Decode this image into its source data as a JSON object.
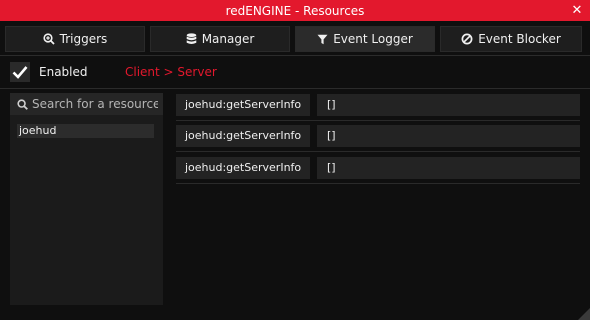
{
  "window": {
    "title": "redENGINE - Resources",
    "close_symbol": "✕"
  },
  "tabs": [
    {
      "label": "Triggers",
      "icon": "search-plus-icon",
      "active": false
    },
    {
      "label": "Manager",
      "icon": "database-icon",
      "active": false
    },
    {
      "label": "Event Logger",
      "icon": "filter-icon",
      "active": true
    },
    {
      "label": "Event Blocker",
      "icon": "ban-icon",
      "active": false
    }
  ],
  "logger": {
    "enabled_label": "Enabled",
    "enabled": true,
    "direction": "Client > Server"
  },
  "resources": {
    "search_placeholder": "Search for a resource",
    "items": [
      {
        "name": "joehud"
      }
    ]
  },
  "events": [
    {
      "name": "joehud:getServerInfo",
      "args": "[]"
    },
    {
      "name": "joehud:getServerInfo",
      "args": "[]"
    },
    {
      "name": "joehud:getServerInfo",
      "args": "[]"
    }
  ],
  "colors": {
    "accent": "#e3182d",
    "background": "#0f0f0f",
    "panel": "#1b1b1b",
    "field": "#232323"
  }
}
